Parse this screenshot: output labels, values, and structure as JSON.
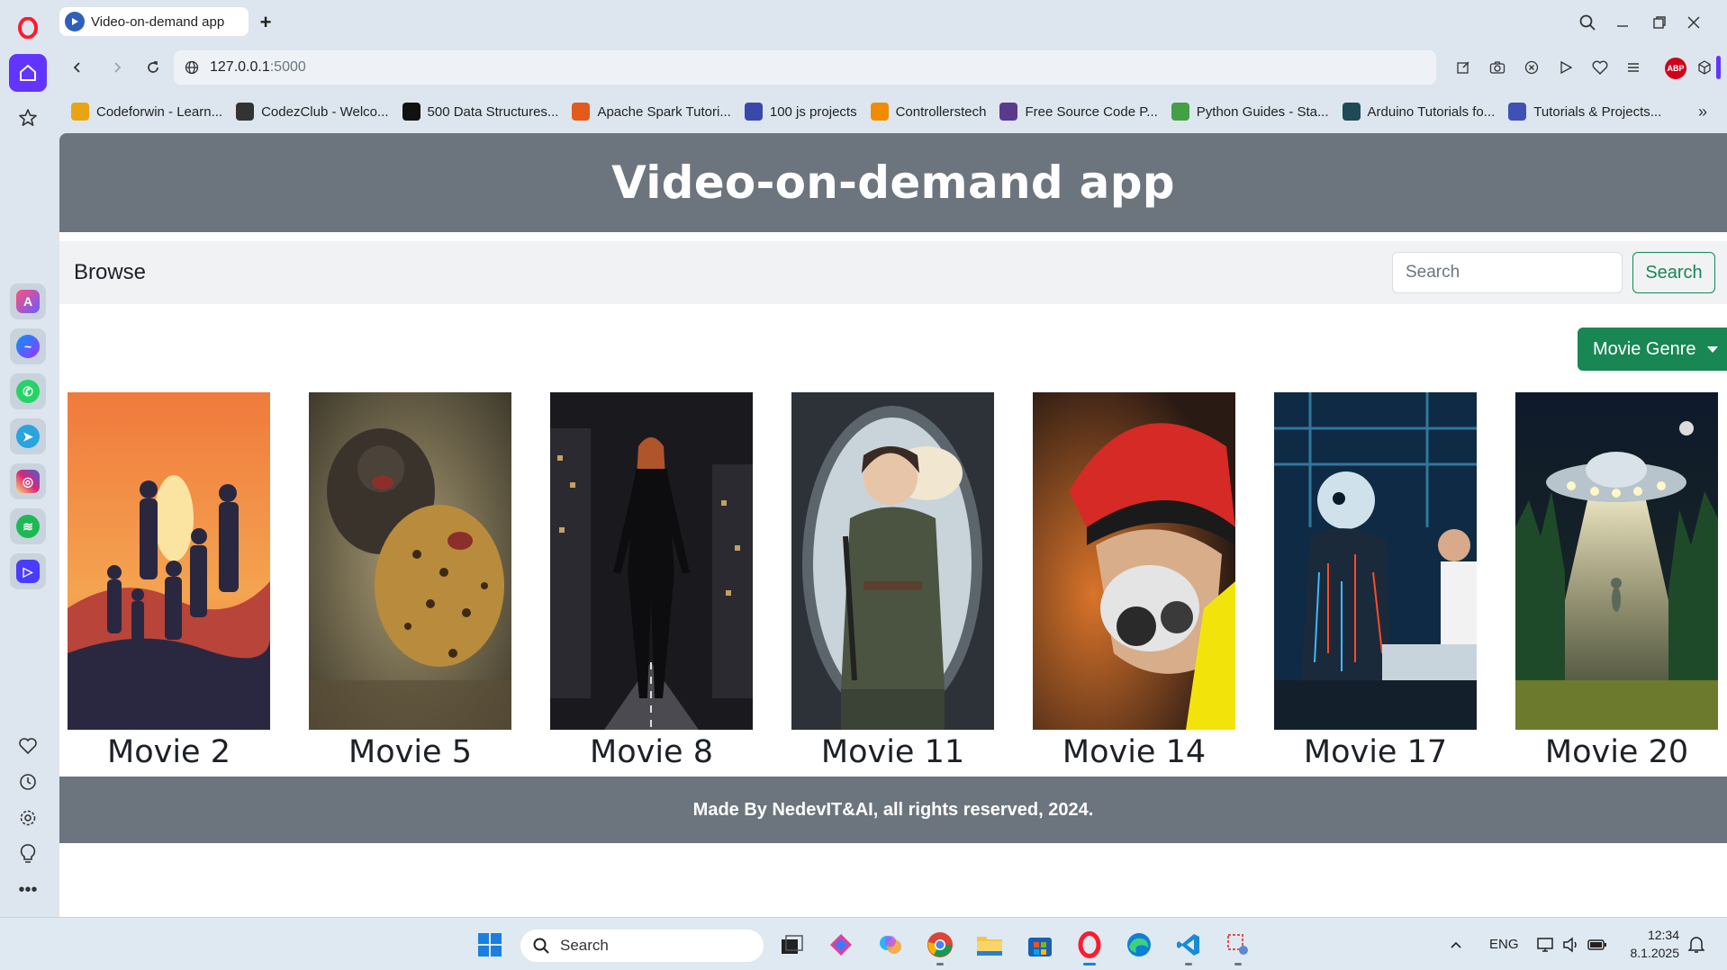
{
  "browser": {
    "tab_title": "Video-on-demand app",
    "url_host": "127.0.0.1",
    "url_port": ":5000",
    "bookmarks": [
      {
        "label": "Codeforwin - Learn...",
        "color": "#e8a512"
      },
      {
        "label": "CodezClub - Welco...",
        "color": "#333333"
      },
      {
        "label": "500 Data Structures...",
        "color": "#111111"
      },
      {
        "label": "Apache Spark Tutori...",
        "color": "#e25a1c"
      },
      {
        "label": "100 js projects",
        "color": "#3949ab"
      },
      {
        "label": "Controllerstech",
        "color": "#f08c00"
      },
      {
        "label": "Free Source Code P...",
        "color": "#5b3a8c"
      },
      {
        "label": "Python Guides - Sta...",
        "color": "#43a047"
      },
      {
        "label": "Arduino Tutorials fo...",
        "color": "#1d4a55"
      },
      {
        "label": "Tutorials & Projects...",
        "color": "#3f51b5"
      }
    ]
  },
  "page": {
    "title": "Video-on-demand app",
    "navbar": {
      "brand": "Browse",
      "search_placeholder": "Search",
      "search_button": "Search"
    },
    "genre_button": "Movie Genre",
    "movies": [
      {
        "title": "Movie 2"
      },
      {
        "title": "Movie 5"
      },
      {
        "title": "Movie 8"
      },
      {
        "title": "Movie 11"
      },
      {
        "title": "Movie 14"
      },
      {
        "title": "Movie 17"
      },
      {
        "title": "Movie 20"
      }
    ],
    "footer": "Made By NedevIT&AI, all rights reserved, 2024."
  },
  "taskbar": {
    "search_label": "Search",
    "lang": "ENG",
    "time": "12:34",
    "date": "8.1.2025"
  },
  "colors": {
    "header_bg": "#6c757d",
    "accent_green": "#198754",
    "opera_red": "#ff1b2d"
  }
}
